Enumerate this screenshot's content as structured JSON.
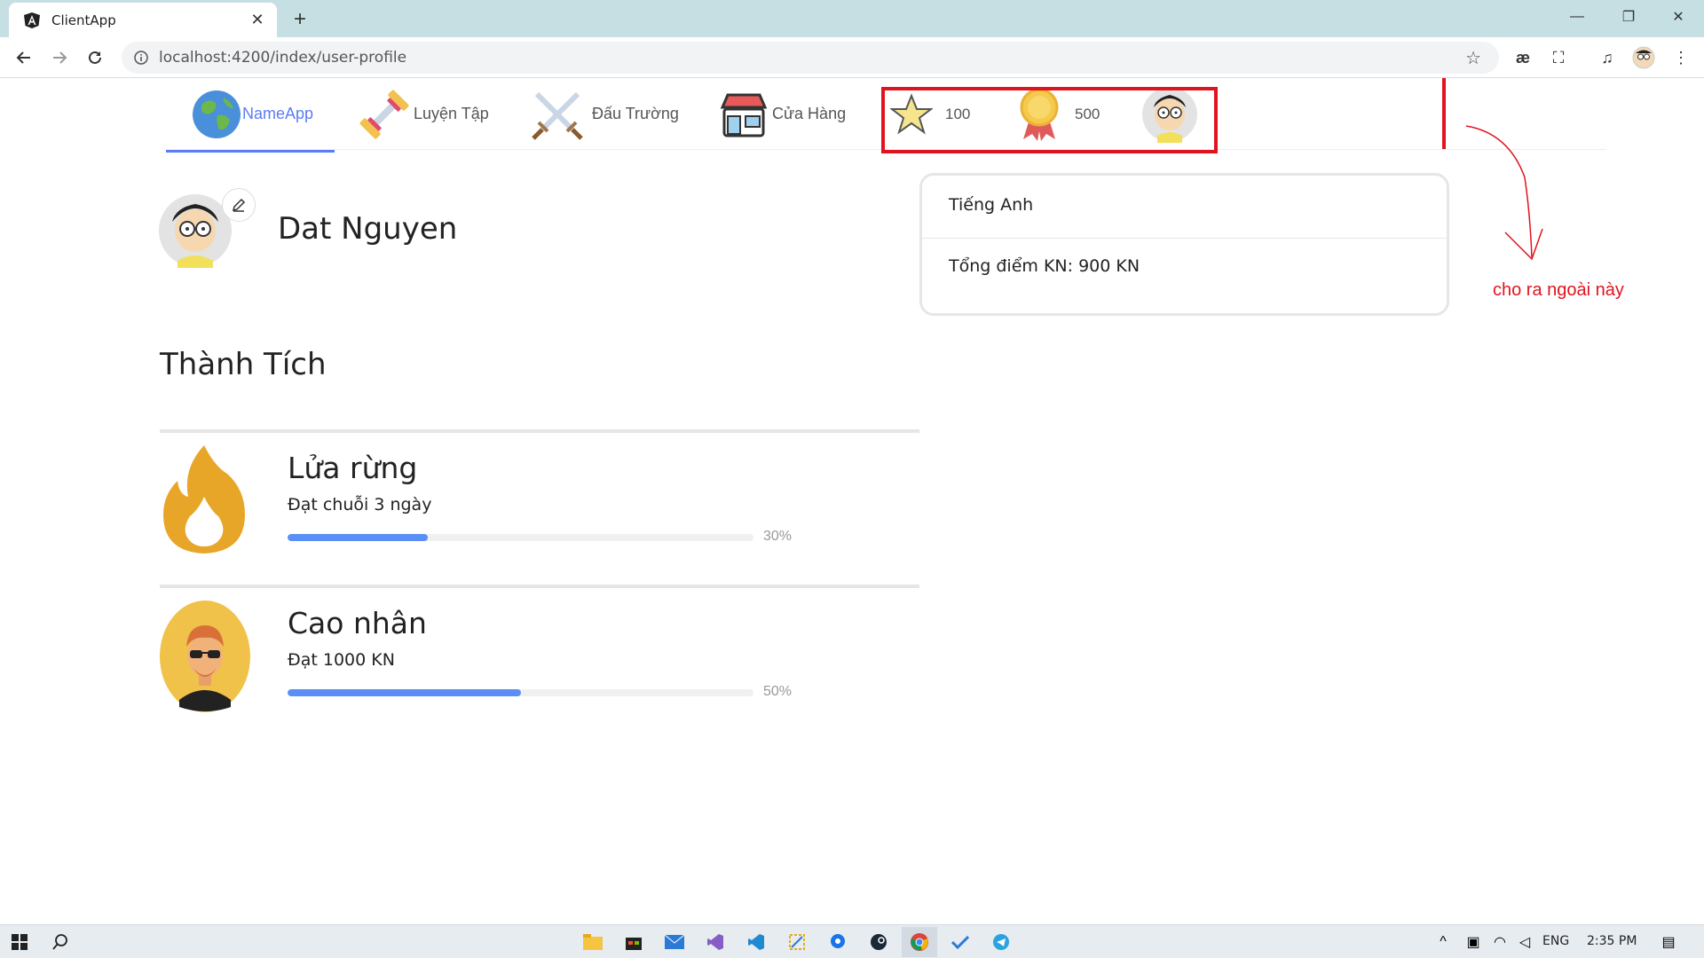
{
  "browser": {
    "tab_title": "ClientApp",
    "url": "localhost:4200/index/user-profile",
    "new_tab_label": "+"
  },
  "nav": {
    "brand": "NameApp",
    "items": [
      {
        "label": "Luyện Tập"
      },
      {
        "label": "Đấu Trường"
      },
      {
        "label": "Cửa Hàng"
      }
    ],
    "stars": "100",
    "medals": "500"
  },
  "profile": {
    "name": "Dat Nguyen"
  },
  "info_card": {
    "language": "Tiếng Anh",
    "total_points": "Tổng điểm KN: 900 KN"
  },
  "annotation": {
    "text": "cho ra ngoài này",
    "color": "#e0141e"
  },
  "achievements": {
    "title": "Thành Tích",
    "items": [
      {
        "title": "Lửa rừng",
        "desc": "Đạt chuỗi 3 ngày",
        "progress": 30,
        "progress_label": "30%"
      },
      {
        "title": "Cao nhân",
        "desc": "Đạt 1000 KN",
        "progress": 50,
        "progress_label": "50%"
      }
    ]
  },
  "taskbar": {
    "lang": "ENG",
    "time": "2:35 PM"
  },
  "colors": {
    "accent": "#5b7cf6",
    "progress": "#5b8ff6",
    "highlight": "#e0141e"
  }
}
